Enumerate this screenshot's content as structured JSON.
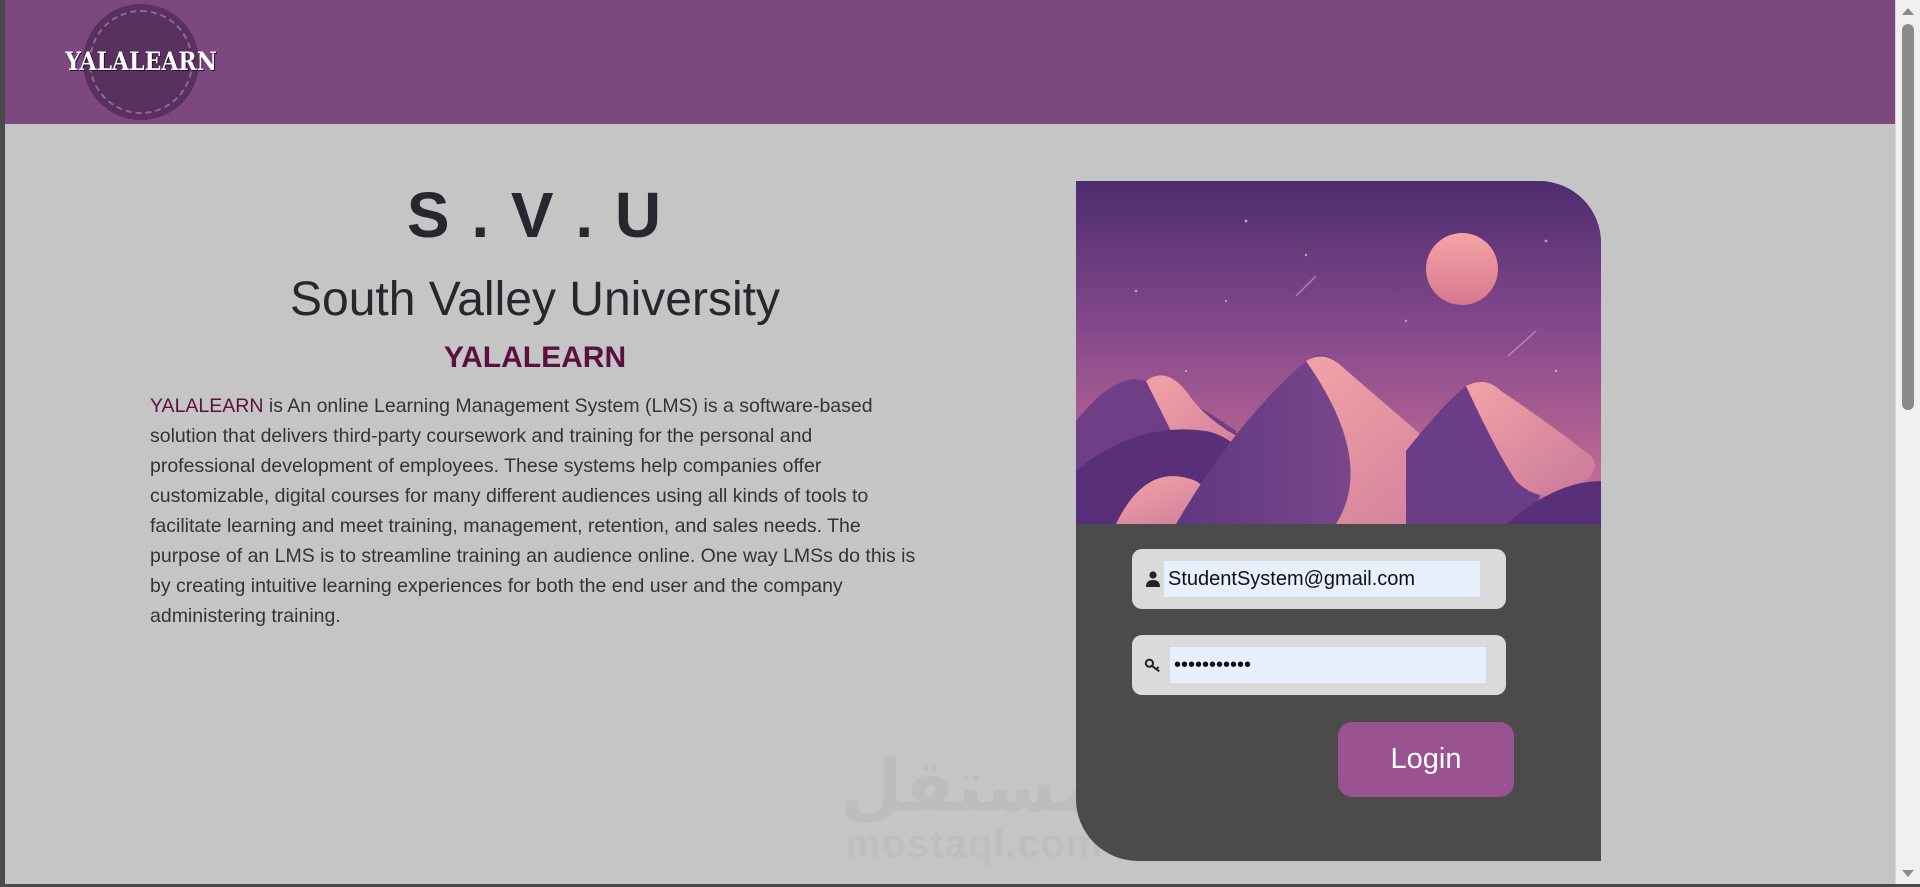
{
  "header": {
    "logo_text": "YALALEARN",
    "background": "#7c487d"
  },
  "intro": {
    "acronym": "S . V . U",
    "university_name": "South Valley University",
    "brand": "YALALEARN",
    "description_highlight": "YALALEARN",
    "description_rest": " is An online Learning Management System (LMS) is a software-based solution that delivers third-party coursework and training for the personal and professional development of employees. These systems help companies offer customizable, digital courses for many different audiences using all kinds of tools to facilitate learning and meet training, management, retention, and sales needs. The purpose of an LMS is to streamline training an audience online. One way LMSs do this is by creating intuitive learning experiences for both the end user and the company administering training."
  },
  "login": {
    "email_value": "StudentSystem@gmail.com",
    "password_value": "•••••••••••",
    "button_label": "Login",
    "user_icon": "user-icon",
    "password_icon": "key-icon"
  },
  "watermark": {
    "arabic": "مستقل",
    "latin": "mostaql.com"
  },
  "colors": {
    "page_background": "#c5c5c5",
    "card_background": "#4b4b4b",
    "brand_text": "#5b1042",
    "button": "#9a5290",
    "input_background": "#e8f0fe"
  }
}
